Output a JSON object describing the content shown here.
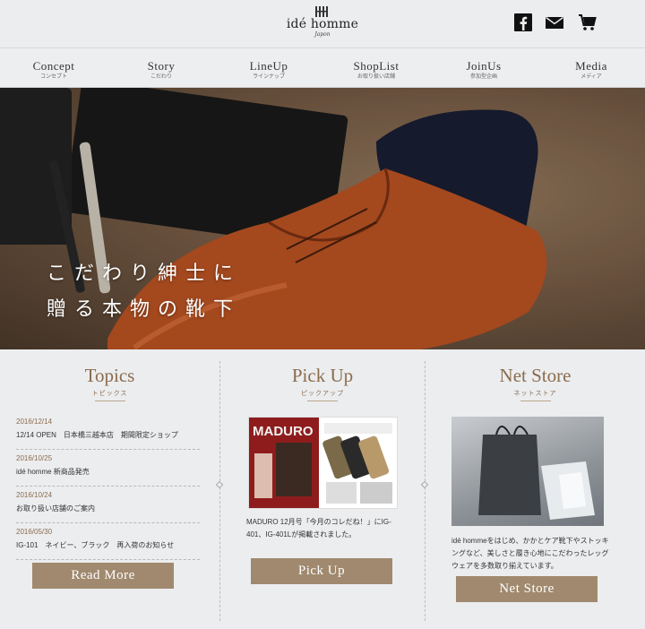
{
  "header": {
    "logo_text": "idé homme",
    "logo_sub": "Japon",
    "icons": [
      "facebook-icon",
      "mail-icon",
      "cart-icon"
    ]
  },
  "nav": [
    {
      "en": "Concept",
      "jp": "コンセプト"
    },
    {
      "en": "Story",
      "jp": "こだわり"
    },
    {
      "en": "LineUp",
      "jp": "ラインナップ"
    },
    {
      "en": "ShopList",
      "jp": "お取り扱い店舗"
    },
    {
      "en": "JoinUs",
      "jp": "参加型企画"
    },
    {
      "en": "Media",
      "jp": "メディア"
    }
  ],
  "hero": {
    "line1": "こだわり紳士に",
    "line2": "贈る本物の靴下"
  },
  "topics": {
    "title": "Topics",
    "subtitle": "トピックス",
    "items": [
      {
        "date": "2016/12/14",
        "text": "12/14 OPEN　日本橋三越本店　期間限定ショップ"
      },
      {
        "date": "2016/10/25",
        "text": "idé homme 新商品発売"
      },
      {
        "date": "2016/10/24",
        "text": "お取り扱い店舗のご案内"
      },
      {
        "date": "2016/05/30",
        "text": "IG-101　ネイビー、ブラック　再入荷のお知らせ"
      }
    ],
    "button": "Read More"
  },
  "pickup": {
    "title": "Pick Up",
    "subtitle": "ピックアップ",
    "mag_title": "MADURO",
    "text": "MADURO 12月号「今月のコレだね！」にIG-401、IG-401Lが掲載されました。",
    "button": "Pick Up"
  },
  "netstore": {
    "title": "Net Store",
    "subtitle": "ネットストア",
    "text": "idé hommeをはじめ、かかとケア靴下やストッキングなど、美しさと履き心地にこだわったレッグウェアを多数取り揃えています。",
    "button": "Net Store"
  },
  "colors": {
    "accent": "#8a6c4c",
    "button": "#a0896e",
    "background": "#eceef0"
  }
}
